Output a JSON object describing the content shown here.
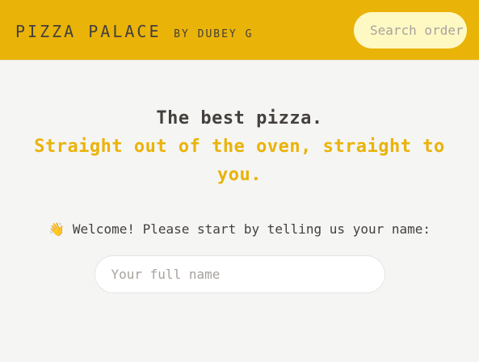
{
  "header": {
    "brand_name": "Pizza Palace",
    "brand_by": "by Dubey G",
    "search_placeholder": "Search order #"
  },
  "main": {
    "headline": "The best pizza.",
    "subheadline": "Straight out of the oven, straight to you.",
    "welcome_emoji": "👋",
    "welcome_text": "Welcome! Please start by telling us your name:",
    "name_placeholder": "Your full name"
  },
  "colors": {
    "brand_yellow": "#eab308",
    "search_bg": "#fef9c3",
    "page_bg": "#f5f5f4",
    "text_dark": "#44403c"
  }
}
